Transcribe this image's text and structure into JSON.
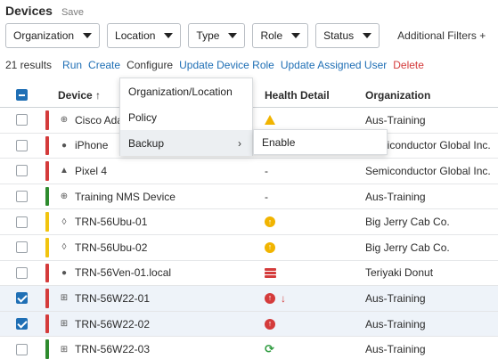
{
  "header": {
    "title": "Devices",
    "save_label": "Save"
  },
  "filters": {
    "items": [
      "Organization",
      "Location",
      "Type",
      "Role",
      "Status"
    ],
    "additional_label": "Additional Filters +"
  },
  "actions": {
    "results": "21 results",
    "run": "Run",
    "create": "Create",
    "configure": "Configure",
    "update_role": "Update Device Role",
    "update_user": "Update Assigned User",
    "delete": "Delete"
  },
  "table": {
    "columns": {
      "device": "Device ↑",
      "health": "Health Detail",
      "organization": "Organization"
    },
    "rows": [
      {
        "name": "Cisco Ada",
        "icon": "globe-icon",
        "status_color": "#d43b3b",
        "health": "warning",
        "org": "Aus-Training",
        "checked": false
      },
      {
        "name": "iPhone",
        "icon": "apple-icon",
        "status_color": "#d43b3b",
        "health": "",
        "org": "Semiconductor Global Inc.",
        "checked": false
      },
      {
        "name": "Pixel 4",
        "icon": "android-icon",
        "status_color": "#d43b3b",
        "health": "-",
        "org": "Semiconductor Global Inc.",
        "checked": false
      },
      {
        "name": "Training NMS Device",
        "icon": "globe-icon",
        "status_color": "#2e8b2e",
        "health": "-",
        "org": "Aus-Training",
        "checked": false
      },
      {
        "name": "TRN-56Ubu-01",
        "icon": "linux-icon",
        "status_color": "#f1c40f",
        "health": "up-yellow",
        "org": "Big Jerry Cab Co.",
        "checked": false
      },
      {
        "name": "TRN-56Ubu-02",
        "icon": "linux-icon",
        "status_color": "#f1c40f",
        "health": "up-yellow",
        "org": "Big Jerry Cab Co.",
        "checked": false
      },
      {
        "name": "TRN-56Ven-01.local",
        "icon": "apple-icon",
        "status_color": "#d43b3b",
        "health": "server-red",
        "org": "Teriyaki Donut",
        "checked": false
      },
      {
        "name": "TRN-56W22-01",
        "icon": "windows-icon",
        "status_color": "#d43b3b",
        "health": "up-red-down",
        "org": "Aus-Training",
        "checked": true
      },
      {
        "name": "TRN-56W22-02",
        "icon": "windows-icon",
        "status_color": "#d43b3b",
        "health": "up-red",
        "org": "Aus-Training",
        "checked": true
      },
      {
        "name": "TRN-56W22-03",
        "icon": "windows-icon",
        "status_color": "#2e8b2e",
        "health": "sync-green",
        "org": "Aus-Training",
        "checked": false
      }
    ]
  },
  "configure_menu": {
    "items": [
      "Organization/Location",
      "Policy",
      "Backup"
    ],
    "submenu_item": "Enable"
  }
}
